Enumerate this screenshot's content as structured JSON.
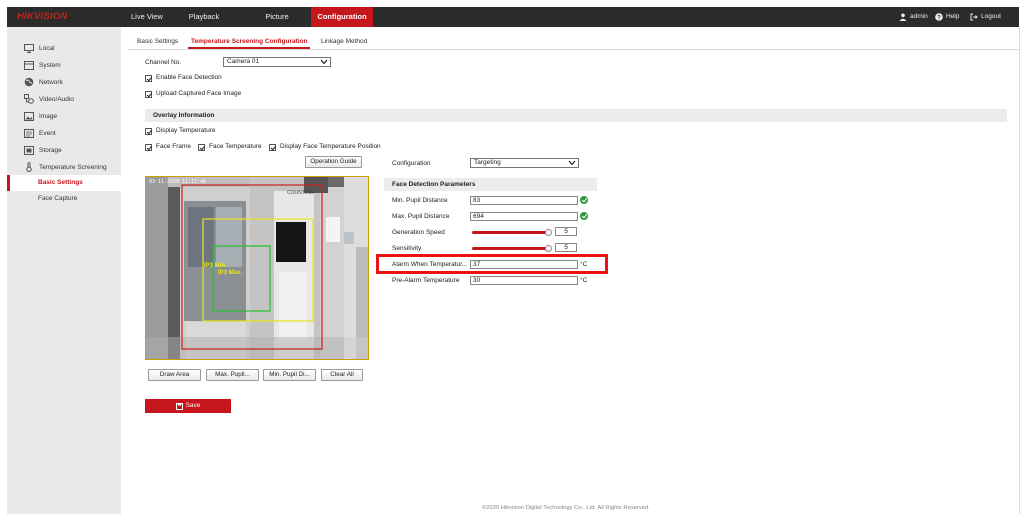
{
  "brand": {
    "logo": "HIKVISION"
  },
  "topnav": {
    "items": [
      {
        "label": "Live View"
      },
      {
        "label": "Playback"
      },
      {
        "label": "Picture"
      },
      {
        "label": "Configuration"
      }
    ],
    "user": "admin",
    "help": "Help",
    "logout": "Logout"
  },
  "sidebar": {
    "items": [
      {
        "label": "Local",
        "icon": "monitor-icon"
      },
      {
        "label": "System",
        "icon": "system-icon"
      },
      {
        "label": "Network",
        "icon": "globe-icon"
      },
      {
        "label": "Video/Audio",
        "icon": "video-audio-icon"
      },
      {
        "label": "Image",
        "icon": "image-icon"
      },
      {
        "label": "Event",
        "icon": "event-icon"
      },
      {
        "label": "Storage",
        "icon": "storage-icon"
      },
      {
        "label": "Temperature Screening",
        "icon": "thermometer-icon"
      }
    ],
    "subitems": [
      {
        "label": "Basic Settings"
      },
      {
        "label": "Face Capture"
      }
    ]
  },
  "tabs": [
    {
      "label": "Basic Settings"
    },
    {
      "label": "Temperature Screening Configuration"
    },
    {
      "label": "Linkage Method"
    }
  ],
  "form": {
    "channel_label": "Channel No.",
    "channel_value": "Camera 01",
    "enable_face_detection": "Enable Face Detection",
    "upload_face_image": "Upload Captured Face Image",
    "overlay_title": "Overlay Information",
    "display_temperature": "Display Temperature",
    "face_frame": "Face Frame",
    "face_temperature": "Face Temperature",
    "display_face_temp_position": "Display Face Temperature Position"
  },
  "video": {
    "osd_time": "03-11-2020 11:17:46",
    "sign_text": "COUNTING",
    "min_label": "IP3 Min.",
    "max_label": "IP3 Max."
  },
  "buttons": {
    "operation_guide": "Operation Guide",
    "draw_area": "Draw Area",
    "max_pupil": "Max. Pupil...",
    "min_pupil": "Min. Pupil Di...",
    "clear_all": "Clear All",
    "save": "Save"
  },
  "params": {
    "configuration_label": "Configuration",
    "configuration_value": "Targeting",
    "section_title": "Face Detection Parameters",
    "min_pupil_label": "Min. Pupil Distance",
    "min_pupil_value": "83",
    "max_pupil_label": "Max. Pupil Distance",
    "max_pupil_value": "694",
    "generation_speed_label": "Generation Speed",
    "generation_speed_value": "5",
    "sensitivity_label": "Sensitivity",
    "sensitivity_value": "5",
    "alarm_temp_label": "Alarm When Temperatur...",
    "alarm_temp_value": "37",
    "alarm_temp_unit": "°C",
    "pre_alarm_label": "Pre-Alarm Temperature",
    "pre_alarm_value": "30",
    "pre_alarm_unit": "°C"
  },
  "footer": {
    "copyright": "©2020 Hikvision Digital Technology Co., Ltd. All Rights Reserved."
  },
  "colors": {
    "accent": "#c4161c",
    "topbar": "#2b2b2b",
    "sidebar": "#e9e9e9",
    "highlight": "#ee1111"
  }
}
